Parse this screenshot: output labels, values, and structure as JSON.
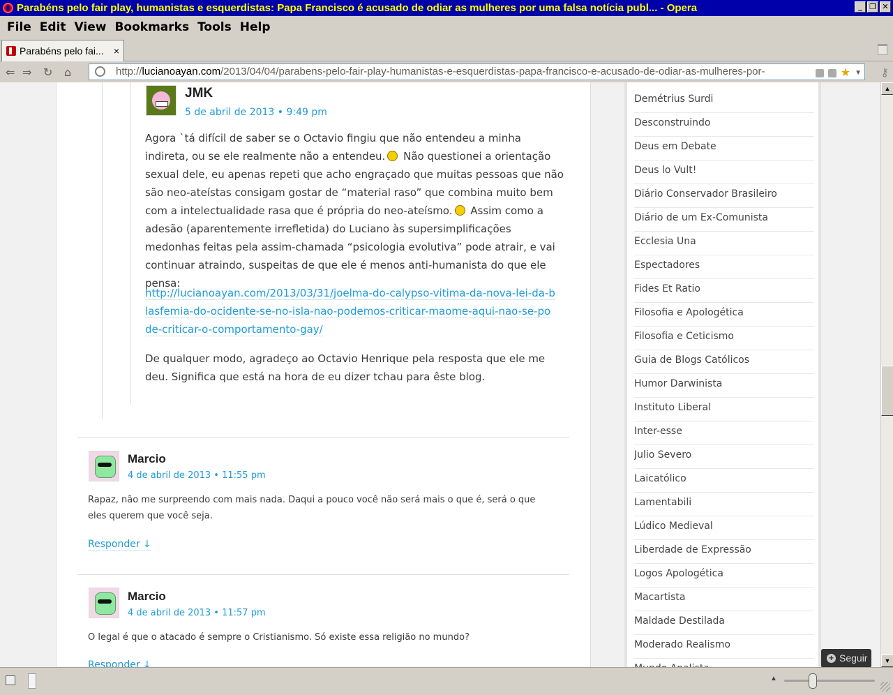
{
  "window": {
    "title": "Parabéns pelo fair play, humanistas e esquerdistas: Papa Francisco é acusado de odiar as mulheres por uma falsa notícia publ... - Opera",
    "minimize": "_",
    "restore": "❐",
    "close": "✕"
  },
  "menu": {
    "file": "File",
    "edit": "Edit",
    "view": "View",
    "bookmarks": "Bookmarks",
    "tools": "Tools",
    "help": "Help"
  },
  "tab": {
    "title": "Parabéns pelo fai...",
    "close": "×"
  },
  "address": {
    "scheme": "http://",
    "domain": "lucianoayan.com",
    "path": "/2013/04/04/parabens-pelo-fair-play-humanistas-e-esquerdistas-papa-francisco-e-acusado-de-odiar-as-mulheres-por-"
  },
  "comments": {
    "jmk": {
      "author": "JMK",
      "date": "5 de abril de 2013 • 9:49 pm",
      "p1_a": "Agora `tá difícil de saber se o Octavio fingiu que não entendeu a minha indireta, ou se ele realmente não a entendeu.",
      "p1_b": " Não questionei a orientação sexual dele, eu apenas repeti que acho engraçado que muitas pessoas que não são neo-ateístas consigam gostar de “material raso” que combina muito bem com a intelectualidade rasa que é própria do neo-ateísmo.",
      "p1_c": " Assim como a adesão (aparentemente irrefletida) do Luciano às supersimplificações medonhas feitas pela assim-chamada “psicologia evolutiva” pode atrair, e vai continuar atraindo, suspeitas de que ele é menos anti-humanista do que ele pensa:",
      "link": "http://lucianoayan.com/2013/03/31/joelma-do-calypso-vitima-da-nova-lei-da-blasfemia-do-ocidente-se-no-isla-nao-podemos-criticar-maome-aqui-nao-se-pode-criticar-o-comportamento-gay/",
      "p3": "De qualquer modo, agradeço ao Octavio Henrique pela resposta que ele me deu. Significa que está na hora de eu dizer tchau para êste blog."
    },
    "marcio1": {
      "author": "Marcio",
      "date": "4 de abril de 2013 • 11:55 pm",
      "text": "Rapaz, não me surpreendo com mais nada. Daqui a pouco você não será mais o que é, será o que eles querem que você seja.",
      "reply": "Responder ↓"
    },
    "marcio2": {
      "author": "Marcio",
      "date": "4 de abril de 2013 • 11:57 pm",
      "text": "O legal é que o atacado é sempre o Cristianismo. Só existe essa religião no mundo?",
      "reply": "Responder ↓"
    }
  },
  "blogroll": [
    "Demétrius Surdi",
    "Desconstruindo",
    "Deus em Debate",
    "Deus lo Vult!",
    "Diário Conservador Brasileiro",
    "Diário de um Ex-Comunista",
    "Ecclesia Una",
    "Espectadores",
    "Fides Et Ratio",
    "Filosofia e Apologética",
    "Filosofia e Ceticismo",
    "Guia de Blogs Católicos",
    "Humor Darwinista",
    "Instituto Liberal",
    "Inter-esse",
    "Julio Severo",
    "Laicatólico",
    "Lamentabili",
    "Lúdico Medieval",
    "Liberdade de Expressão",
    "Logos Apologética",
    "Macartista",
    "Maldade Destilada",
    "Moderado Realismo",
    "Mundo Analista"
  ],
  "follow": {
    "label": "Seguir"
  },
  "colors": {
    "link": "#1e9bd7",
    "titlebar_bg": "#0000aa",
    "titlebar_text": "#ffff00"
  }
}
